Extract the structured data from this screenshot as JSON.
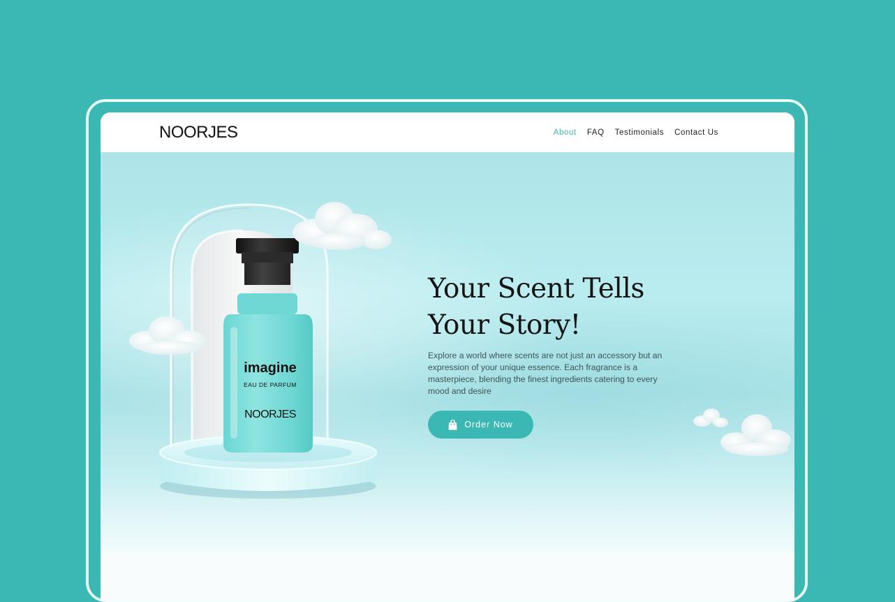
{
  "brand": {
    "logo_text": "NOORJES"
  },
  "nav": {
    "links": [
      {
        "label": "About",
        "active": true
      },
      {
        "label": "FAQ",
        "active": false
      },
      {
        "label": "Testimonials",
        "active": false
      },
      {
        "label": "Contact Us",
        "active": false
      }
    ]
  },
  "hero": {
    "headline_line1": "Your Scent Tells",
    "headline_line2": "Your Story!",
    "description": "Explore a world where scents are not just an accessory but an expression of your unique essence. Each fragrance is a masterpiece, blending the finest ingredients catering to every mood and desire",
    "cta_label": "Order Now",
    "cta_icon": "shopping-bag-icon"
  },
  "product": {
    "name": "imagine",
    "type": "EAU DE PARFUM",
    "brand": "NOORJES"
  },
  "colors": {
    "accent": "#3bb8b3",
    "page_background": "#3bb8b3",
    "hero_background": "#b4e9ec",
    "text_dark": "#151515"
  }
}
